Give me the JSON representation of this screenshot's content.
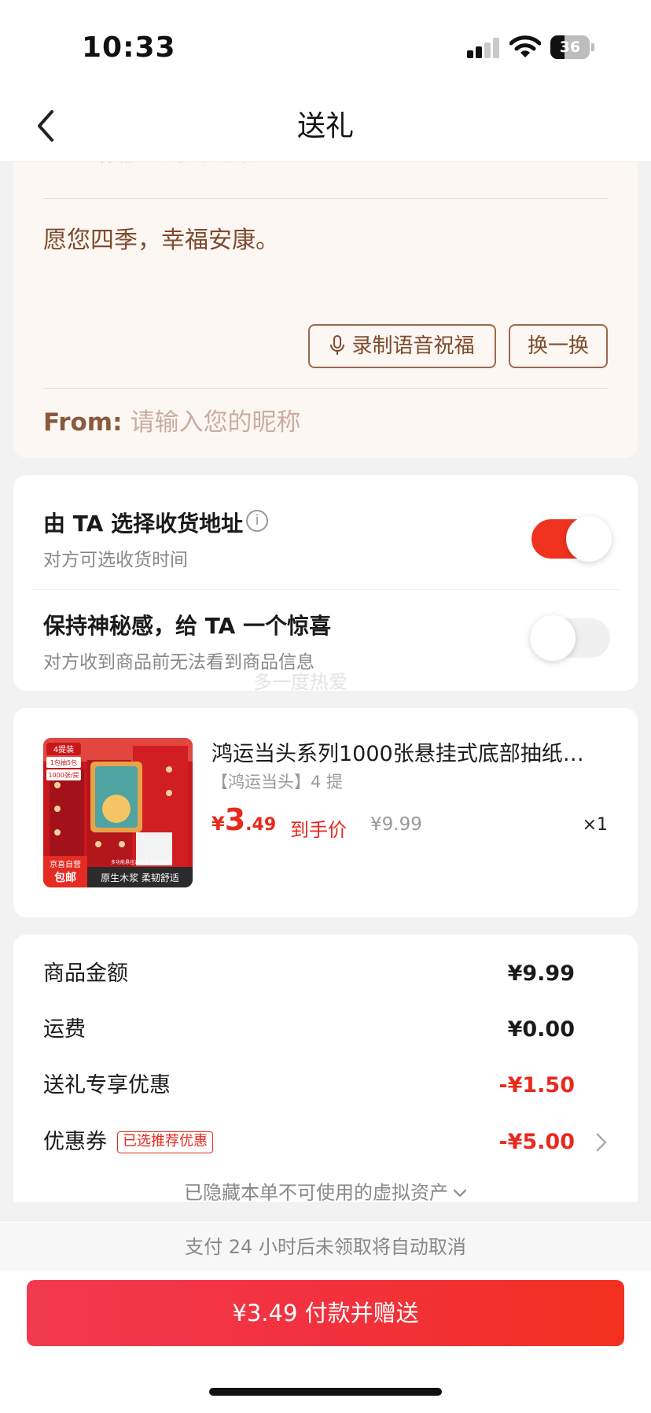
{
  "status_bar": {
    "time": "10:33",
    "battery": "36"
  },
  "nav": {
    "title": "送礼"
  },
  "greeting": {
    "to_label": "To:",
    "to_placeholder": "请输入对方昵称",
    "message": "愿您四季，幸福安康。",
    "voice_button": "录制语音祝福",
    "swap_button": "换一换",
    "from_label": "From:",
    "from_placeholder": "请输入您的昵称"
  },
  "options": {
    "address": {
      "title": "由 TA 选择收货地址",
      "subtitle": "对方可选收货时间",
      "enabled": true
    },
    "mystery": {
      "title": "保持神秘感，给 TA 一个惊喜",
      "subtitle": "对方收到商品前无法看到商品信息",
      "enabled": false
    },
    "watermark": "多一度热爱"
  },
  "product": {
    "title": "鸿运当头系列1000张悬挂式底部抽纸…",
    "spec": "【鸿运当头】4 提",
    "price_currency": "¥",
    "price_int": "3",
    "price_dec": ".49",
    "price_tag": "到手价",
    "original_price": "¥9.99",
    "quantity": "×1",
    "image": {
      "badge_top": "4提装",
      "badge_pack": "1包抽5包",
      "badge_count": "1000张/提",
      "corner_top": "京喜自营",
      "corner_bottom": "包邮",
      "footer": "原生木浆 柔韧舒适",
      "footer_small": "多功能悬挂式纸巾 加大加厚"
    }
  },
  "summary": {
    "rows": [
      {
        "label": "商品金额",
        "value": "¥9.99",
        "red": false
      },
      {
        "label": "运费",
        "value": "¥0.00",
        "red": false
      },
      {
        "label": "送礼专享优惠",
        "value": "-¥1.50",
        "red": true
      },
      {
        "label": "优惠券",
        "value": "-¥5.00",
        "red": true
      }
    ],
    "coupon_badge": "已选推荐优惠",
    "hidden_assets": "已隐藏本单不可使用的虚拟资产"
  },
  "footer": {
    "cancel_note": "支付 24 小时后未领取将自动取消",
    "pay_button": "¥3.49 付款并赠送"
  },
  "colors": {
    "accent": "#e8291c",
    "brown": "#7d4b2e",
    "toggle_on": "#ef3320"
  }
}
